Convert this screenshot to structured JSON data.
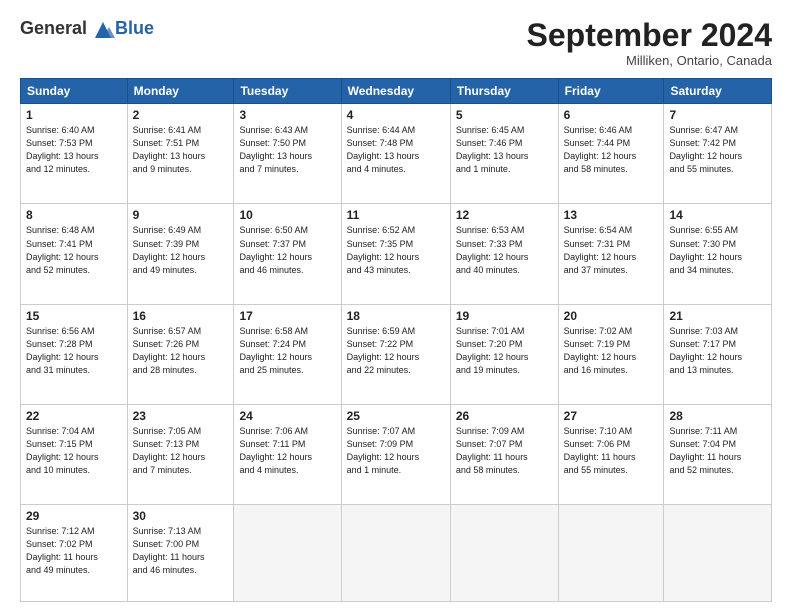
{
  "header": {
    "logo_line1": "General",
    "logo_line2": "Blue",
    "month": "September 2024",
    "location": "Milliken, Ontario, Canada"
  },
  "weekdays": [
    "Sunday",
    "Monday",
    "Tuesday",
    "Wednesday",
    "Thursday",
    "Friday",
    "Saturday"
  ],
  "weeks": [
    [
      {
        "day": "1",
        "info": "Sunrise: 6:40 AM\nSunset: 7:53 PM\nDaylight: 13 hours\nand 12 minutes."
      },
      {
        "day": "2",
        "info": "Sunrise: 6:41 AM\nSunset: 7:51 PM\nDaylight: 13 hours\nand 9 minutes."
      },
      {
        "day": "3",
        "info": "Sunrise: 6:43 AM\nSunset: 7:50 PM\nDaylight: 13 hours\nand 7 minutes."
      },
      {
        "day": "4",
        "info": "Sunrise: 6:44 AM\nSunset: 7:48 PM\nDaylight: 13 hours\nand 4 minutes."
      },
      {
        "day": "5",
        "info": "Sunrise: 6:45 AM\nSunset: 7:46 PM\nDaylight: 13 hours\nand 1 minute."
      },
      {
        "day": "6",
        "info": "Sunrise: 6:46 AM\nSunset: 7:44 PM\nDaylight: 12 hours\nand 58 minutes."
      },
      {
        "day": "7",
        "info": "Sunrise: 6:47 AM\nSunset: 7:42 PM\nDaylight: 12 hours\nand 55 minutes."
      }
    ],
    [
      {
        "day": "8",
        "info": "Sunrise: 6:48 AM\nSunset: 7:41 PM\nDaylight: 12 hours\nand 52 minutes."
      },
      {
        "day": "9",
        "info": "Sunrise: 6:49 AM\nSunset: 7:39 PM\nDaylight: 12 hours\nand 49 minutes."
      },
      {
        "day": "10",
        "info": "Sunrise: 6:50 AM\nSunset: 7:37 PM\nDaylight: 12 hours\nand 46 minutes."
      },
      {
        "day": "11",
        "info": "Sunrise: 6:52 AM\nSunset: 7:35 PM\nDaylight: 12 hours\nand 43 minutes."
      },
      {
        "day": "12",
        "info": "Sunrise: 6:53 AM\nSunset: 7:33 PM\nDaylight: 12 hours\nand 40 minutes."
      },
      {
        "day": "13",
        "info": "Sunrise: 6:54 AM\nSunset: 7:31 PM\nDaylight: 12 hours\nand 37 minutes."
      },
      {
        "day": "14",
        "info": "Sunrise: 6:55 AM\nSunset: 7:30 PM\nDaylight: 12 hours\nand 34 minutes."
      }
    ],
    [
      {
        "day": "15",
        "info": "Sunrise: 6:56 AM\nSunset: 7:28 PM\nDaylight: 12 hours\nand 31 minutes."
      },
      {
        "day": "16",
        "info": "Sunrise: 6:57 AM\nSunset: 7:26 PM\nDaylight: 12 hours\nand 28 minutes."
      },
      {
        "day": "17",
        "info": "Sunrise: 6:58 AM\nSunset: 7:24 PM\nDaylight: 12 hours\nand 25 minutes."
      },
      {
        "day": "18",
        "info": "Sunrise: 6:59 AM\nSunset: 7:22 PM\nDaylight: 12 hours\nand 22 minutes."
      },
      {
        "day": "19",
        "info": "Sunrise: 7:01 AM\nSunset: 7:20 PM\nDaylight: 12 hours\nand 19 minutes."
      },
      {
        "day": "20",
        "info": "Sunrise: 7:02 AM\nSunset: 7:19 PM\nDaylight: 12 hours\nand 16 minutes."
      },
      {
        "day": "21",
        "info": "Sunrise: 7:03 AM\nSunset: 7:17 PM\nDaylight: 12 hours\nand 13 minutes."
      }
    ],
    [
      {
        "day": "22",
        "info": "Sunrise: 7:04 AM\nSunset: 7:15 PM\nDaylight: 12 hours\nand 10 minutes."
      },
      {
        "day": "23",
        "info": "Sunrise: 7:05 AM\nSunset: 7:13 PM\nDaylight: 12 hours\nand 7 minutes."
      },
      {
        "day": "24",
        "info": "Sunrise: 7:06 AM\nSunset: 7:11 PM\nDaylight: 12 hours\nand 4 minutes."
      },
      {
        "day": "25",
        "info": "Sunrise: 7:07 AM\nSunset: 7:09 PM\nDaylight: 12 hours\nand 1 minute."
      },
      {
        "day": "26",
        "info": "Sunrise: 7:09 AM\nSunset: 7:07 PM\nDaylight: 11 hours\nand 58 minutes."
      },
      {
        "day": "27",
        "info": "Sunrise: 7:10 AM\nSunset: 7:06 PM\nDaylight: 11 hours\nand 55 minutes."
      },
      {
        "day": "28",
        "info": "Sunrise: 7:11 AM\nSunset: 7:04 PM\nDaylight: 11 hours\nand 52 minutes."
      }
    ],
    [
      {
        "day": "29",
        "info": "Sunrise: 7:12 AM\nSunset: 7:02 PM\nDaylight: 11 hours\nand 49 minutes."
      },
      {
        "day": "30",
        "info": "Sunrise: 7:13 AM\nSunset: 7:00 PM\nDaylight: 11 hours\nand 46 minutes."
      },
      {
        "day": "",
        "info": ""
      },
      {
        "day": "",
        "info": ""
      },
      {
        "day": "",
        "info": ""
      },
      {
        "day": "",
        "info": ""
      },
      {
        "day": "",
        "info": ""
      }
    ]
  ]
}
